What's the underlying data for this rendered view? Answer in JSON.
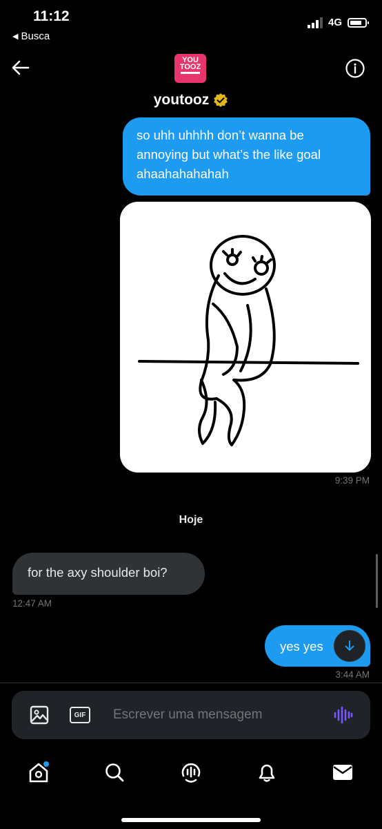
{
  "status_bar": {
    "time": "11:12",
    "back_app": "Busca",
    "network": "4G"
  },
  "header": {
    "contact_name": "youtooz",
    "avatar_text_line1": "YOU",
    "avatar_text_line2": "TOOZ",
    "icons": [
      "back-arrow-icon",
      "info-icon",
      "verified-badge-icon"
    ]
  },
  "conversation": {
    "messages": [
      {
        "direction": "outgoing",
        "type": "text",
        "text": "so uhh uhhhh don’t wanna be annoying but what’s the like goal ahaahahahahah"
      },
      {
        "direction": "outgoing",
        "type": "image",
        "timestamp": "9:39 PM"
      },
      {
        "direction": "incoming",
        "type": "text",
        "text": "for the axy shoulder boi?",
        "timestamp": "12:47 AM"
      },
      {
        "direction": "outgoing",
        "type": "text",
        "text": "yes yes",
        "timestamp": "3:44 AM"
      }
    ],
    "day_separator": "Hoje"
  },
  "composer": {
    "placeholder": "Escrever uma mensagem",
    "gif_label": "GIF"
  },
  "nav": {
    "items": [
      "home-icon",
      "search-icon",
      "spaces-icon",
      "notifications-icon",
      "messages-icon"
    ],
    "home_has_badge": true
  },
  "colors": {
    "accent": "#1d9bf0",
    "incoming_bubble": "#2f3336",
    "background": "#000000",
    "verified": "#e2b719",
    "avatar": "#e8356d",
    "voice": "#7856ff"
  }
}
